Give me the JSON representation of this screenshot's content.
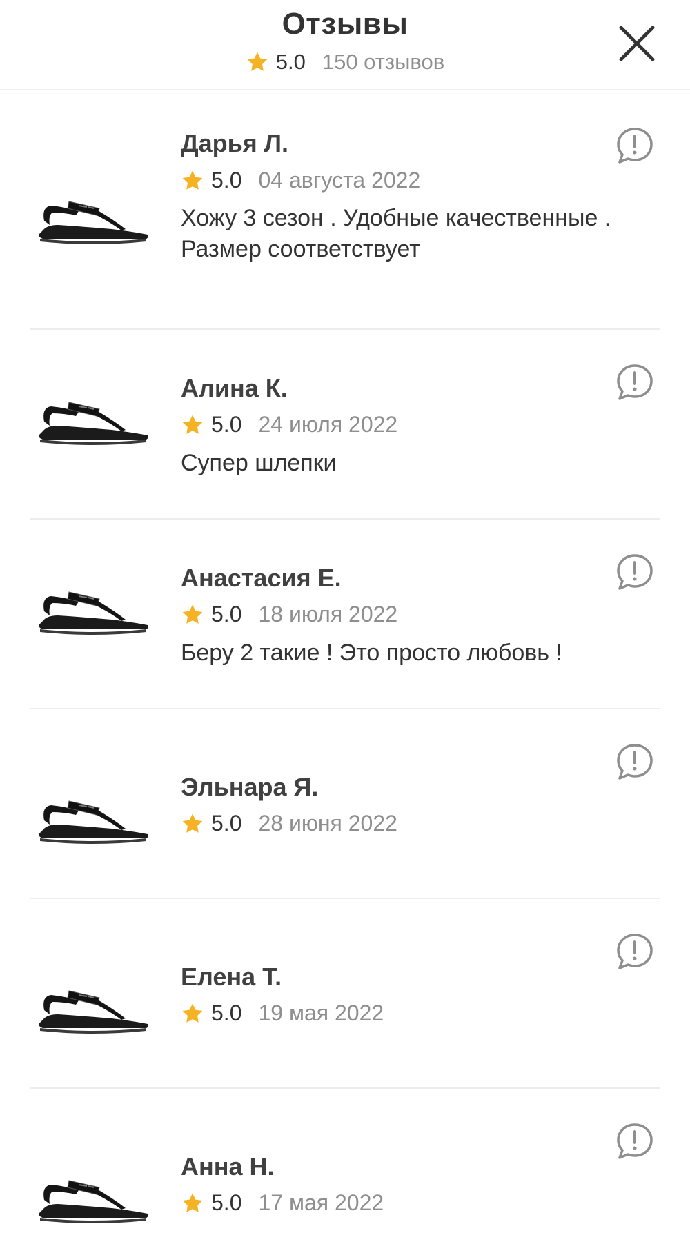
{
  "header": {
    "title": "Отзывы",
    "rating": "5.0",
    "count": "150 отзывов"
  },
  "icons": {
    "star": "star-icon",
    "close": "close-icon",
    "report": "report-icon",
    "product": "sandal-thumbnail"
  },
  "colors": {
    "star": "#F5B323",
    "text": "#333333",
    "muted": "#8E8E8E",
    "divider": "#EDEDED"
  },
  "reviews": [
    {
      "author": "Дарья Л.",
      "rating": "5.0",
      "date": "04 августа 2022",
      "text": "Хожу 3 сезон . Удобные качественные . Размер соответствует"
    },
    {
      "author": "Алина К.",
      "rating": "5.0",
      "date": "24 июля 2022",
      "text": "Супер шлепки"
    },
    {
      "author": "Анастасия Е.",
      "rating": "5.0",
      "date": "18 июля 2022",
      "text": "Беру 2 такие ! Это просто любовь !"
    },
    {
      "author": "Эльнара Я.",
      "rating": "5.0",
      "date": "28 июня 2022",
      "text": ""
    },
    {
      "author": "Елена Т.",
      "rating": "5.0",
      "date": "19 мая 2022",
      "text": ""
    },
    {
      "author": "Анна Н.",
      "rating": "5.0",
      "date": "17 мая 2022",
      "text": ""
    }
  ]
}
